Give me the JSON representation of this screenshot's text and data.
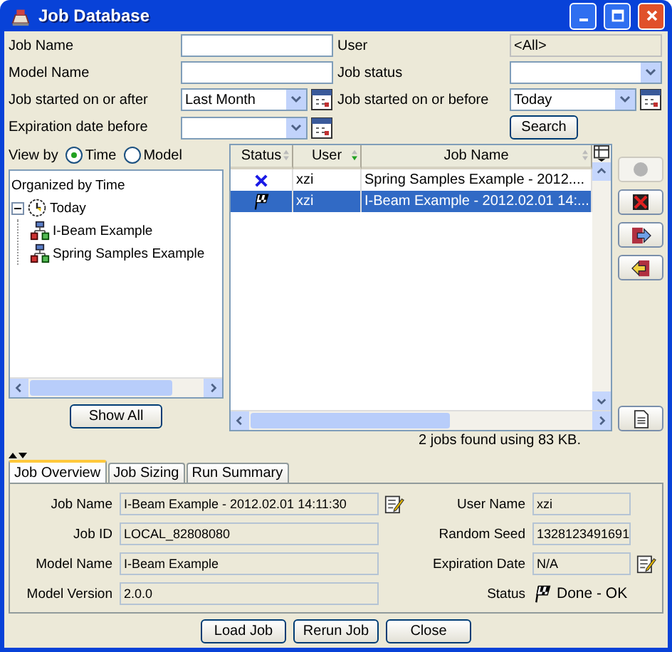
{
  "window": {
    "title": "Job Database"
  },
  "filters": [
    {
      "label": "Job Name",
      "kind": "text"
    },
    {
      "label": "User",
      "kind": "readonly",
      "value": "<All>"
    },
    {
      "label": "Model Name",
      "kind": "text"
    },
    {
      "label": "Job status",
      "kind": "combo"
    },
    {
      "label": "Job started on or after",
      "kind": "date",
      "value": "Last Month"
    },
    {
      "label": "Job started on or before",
      "kind": "date",
      "value": "Today"
    },
    {
      "label": "Expiration date before",
      "kind": "date"
    }
  ],
  "search_button": "Search",
  "view_by": {
    "label": "View by",
    "options": [
      {
        "label": "Time",
        "selected": true
      },
      {
        "label": "Model",
        "selected": false
      }
    ]
  },
  "tree": {
    "heading": "Organized by Time",
    "items": [
      {
        "label": "Today",
        "kind": "date",
        "expanded": true,
        "children": [
          {
            "label": "I-Beam Example",
            "kind": "job"
          },
          {
            "label": "Spring Samples Example",
            "kind": "job"
          }
        ]
      }
    ]
  },
  "show_all_button": "Show All",
  "table": {
    "columns": [
      {
        "label": "Status",
        "sorted": false
      },
      {
        "label": "User",
        "sorted": true
      },
      {
        "label": "Job Name",
        "sorted": false
      }
    ],
    "rows": [
      {
        "kind": "failed",
        "user": "xzi",
        "job_name": "Spring Samples Example - 2012....",
        "selected": false
      },
      {
        "kind": "done",
        "user": "xzi",
        "job_name": "I-Beam Example - 2012.02.01 14:...",
        "selected": true
      }
    ]
  },
  "side_buttons": [
    {
      "kind": "record",
      "disabled": true
    },
    {
      "kind": "delete",
      "disabled": false
    },
    {
      "kind": "export",
      "disabled": false
    },
    {
      "kind": "import",
      "disabled": false
    }
  ],
  "report_button": {
    "kind": "report",
    "disabled": false
  },
  "status_text": "2 jobs found using 83 KB.",
  "tabs": [
    {
      "label": "Job Overview",
      "selected": true
    },
    {
      "label": "Job Sizing",
      "selected": false
    },
    {
      "label": "Run Summary",
      "selected": false
    }
  ],
  "overview": [
    {
      "label": "Job Name",
      "value": "I-Beam Example - 2012.02.01 14:11:30",
      "kind": "field",
      "editable": true
    },
    {
      "label": "User Name",
      "value": "xzi",
      "kind": "field",
      "editable": false
    },
    {
      "label": "Job ID",
      "value": "LOCAL_82808080",
      "kind": "field",
      "editable": false
    },
    {
      "label": "Random Seed",
      "value": "1328123491691",
      "kind": "field",
      "editable": false
    },
    {
      "label": "Model Name",
      "value": "I-Beam Example",
      "kind": "field",
      "editable": false
    },
    {
      "label": "Expiration Date",
      "value": "N/A",
      "kind": "field",
      "editable": true
    },
    {
      "label": "Model Version",
      "value": "2.0.0",
      "kind": "field",
      "editable": false
    },
    {
      "label": "Status",
      "value": "Done - OK",
      "kind": "status",
      "editable": false
    }
  ],
  "buttons": [
    "Load Job",
    "Rerun Job",
    "Close"
  ]
}
